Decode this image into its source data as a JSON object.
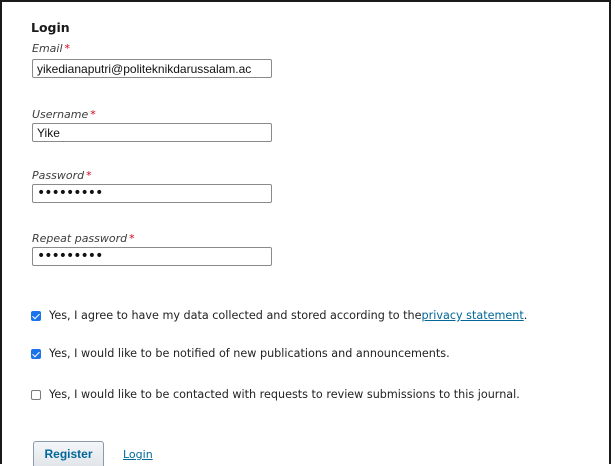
{
  "section": {
    "title": "Login"
  },
  "fields": {
    "email": {
      "label": "Email",
      "required_mark": "*",
      "value": "yikedianaputri@politeknikdarussalam.ac"
    },
    "username": {
      "label": "Username",
      "required_mark": "*",
      "value": "Yike"
    },
    "password": {
      "label": "Password",
      "required_mark": "*",
      "value": "•••••••••"
    },
    "repeat_password": {
      "label": "Repeat password",
      "required_mark": "*",
      "value": "•••••••••"
    }
  },
  "consents": {
    "privacy": {
      "checked": true,
      "text": "Yes, I agree to have my data collected and stored according to the ",
      "link_text": "privacy statement",
      "suffix": "."
    },
    "notify": {
      "checked": true,
      "text": "Yes, I would like to be notified of new publications and announcements."
    },
    "review": {
      "checked": false,
      "text": "Yes, I would like to be contacted with requests to review submissions to this journal."
    }
  },
  "actions": {
    "register_label": "Register",
    "login_label": "Login"
  },
  "colors": {
    "link": "#006798",
    "required": "#d0021b",
    "checkbox_on": "#1a73e8"
  }
}
